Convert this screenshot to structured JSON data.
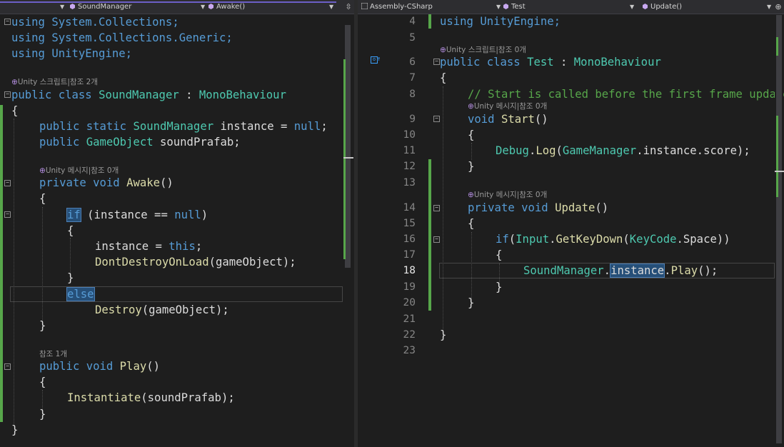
{
  "left_editor": {
    "nav": {
      "class_dropdown": "SoundManager",
      "member_dropdown": "Awake()",
      "split_icon": "split-pin-icon"
    },
    "lines": {
      "l1": "using System.Collections;",
      "l2": "using System.Collections.Generic;",
      "l3": "using UnityEngine;",
      "lens_class": "Unity 스크립트|참조 2개",
      "class_decl": {
        "kw": "public class ",
        "name": "SoundManager",
        "sep": " : ",
        "base": "MonoBehaviour"
      },
      "open_brace": "{",
      "field1": {
        "kw": "public static ",
        "type": "SoundManager",
        "rest": " instance = ",
        "null": "null",
        "end": ";"
      },
      "field2": {
        "kw": "public ",
        "type": "GameObject",
        "rest": " soundPrafab;"
      },
      "lens_awake": "Unity 메시지|참조 0개",
      "awake_decl": {
        "kw": "private void ",
        "name": "Awake",
        "rest": "()"
      },
      "awake_open": "{",
      "if_line": {
        "kw": "if",
        "rest": " (instance == ",
        "null": "null",
        "end": ")"
      },
      "if_open": "{",
      "assign": {
        "rest": "instance = ",
        "kw": "this",
        "end": ";"
      },
      "ddol": {
        "fn": "DontDestroyOnLoad",
        "rest": "(gameObject);"
      },
      "if_close": "}",
      "else_kw": "else",
      "destroy": {
        "fn": "Destroy",
        "rest": "(gameObject);"
      },
      "awake_close": "}",
      "lens_play": "참조 1개",
      "play_decl": {
        "kw": "public void ",
        "name": "Play",
        "rest": "()"
      },
      "play_open": "{",
      "inst": {
        "fn": "Instantiate",
        "rest": "(soundPrafab);"
      },
      "play_close": "}",
      "class_close": "}"
    }
  },
  "right_editor": {
    "nav": {
      "project_dropdown": "Assembly-CSharp",
      "class_dropdown": "Test",
      "member_dropdown": "Update()",
      "add_icon": "add-icon"
    },
    "line_numbers": [
      "4",
      "5",
      "6",
      "7",
      "8",
      "9",
      "10",
      "11",
      "12",
      "13",
      "14",
      "15",
      "16",
      "17",
      "18",
      "19",
      "20",
      "21",
      "22",
      "23"
    ],
    "current_line": "18",
    "lines": {
      "l4": "using UnityEngine;",
      "lens_class": "Unity 스크립트|참조 0개",
      "class_decl": {
        "kw": "public class ",
        "name": "Test",
        "sep": " : ",
        "base": "MonoBehaviour"
      },
      "l7": "{",
      "l8": "// Start is called before the first frame update",
      "lens_start": "Unity 메시지|참조 0개",
      "l9": {
        "kw": "void ",
        "name": "Start",
        "rest": "()"
      },
      "l10": "{",
      "l11": {
        "cls": "Debug",
        "dot": ".",
        "fn": "Log",
        "open": "(",
        "cls2": "GameManager",
        "rest": ".instance.score);"
      },
      "l12": "}",
      "lens_update": "Unity 메시지|참조 0개",
      "l14": {
        "kw": "private void ",
        "name": "Update",
        "rest": "()"
      },
      "l15": "{",
      "l16": {
        "kw": "if",
        "open": "(",
        "cls": "Input",
        "dot": ".",
        "fn": "GetKeyDown",
        "open2": "(",
        "cls2": "KeyCode",
        "rest": ".Space))"
      },
      "l17": "{",
      "l18": {
        "cls": "SoundManager",
        "dot": ".",
        "hl": "instance",
        "dot2": ".",
        "fn": "Play",
        "rest": "();"
      },
      "l19": "}",
      "l20": "}",
      "l22": "}"
    }
  },
  "colors": {
    "background": "#1e1e1e",
    "keyword": "#569cd6",
    "type": "#4ec9b0",
    "method": "#dcdcaa",
    "comment": "#57a64a",
    "change_bar": "#57a64a",
    "selection": "#264f78"
  }
}
